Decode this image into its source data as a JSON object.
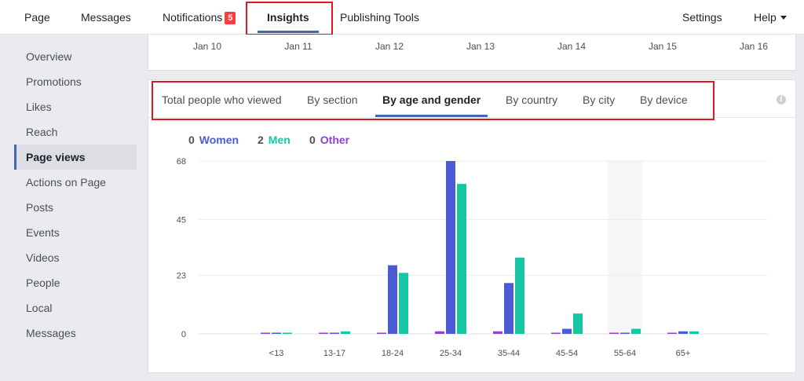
{
  "topnav": {
    "page": "Page",
    "messages": "Messages",
    "notifications": "Notifications",
    "notifications_badge": "5",
    "insights": "Insights",
    "publishing_tools": "Publishing Tools",
    "settings": "Settings",
    "help": "Help"
  },
  "sidebar": {
    "items": [
      {
        "label": "Overview"
      },
      {
        "label": "Promotions"
      },
      {
        "label": "Likes"
      },
      {
        "label": "Reach"
      },
      {
        "label": "Page views"
      },
      {
        "label": "Actions on Page"
      },
      {
        "label": "Posts"
      },
      {
        "label": "Events"
      },
      {
        "label": "Videos"
      },
      {
        "label": "People"
      },
      {
        "label": "Local"
      },
      {
        "label": "Messages"
      }
    ],
    "active_index": 4
  },
  "dates": [
    "Jan 10",
    "Jan 11",
    "Jan 12",
    "Jan 13",
    "Jan 14",
    "Jan 15",
    "Jan 16"
  ],
  "tabs": {
    "total": "Total people who viewed",
    "section": "By section",
    "age_gender": "By age and gender",
    "country": "By country",
    "city": "By city",
    "device": "By device"
  },
  "legend": {
    "women_count": "0",
    "women_label": "Women",
    "men_count": "2",
    "men_label": "Men",
    "other_count": "0",
    "other_label": "Other"
  },
  "colors": {
    "women": "#4c5bd4",
    "men": "#19c6a3",
    "other": "#8e44c8",
    "accent": "#4267b2",
    "highlight_box": "#e0171f"
  },
  "chart_data": {
    "type": "bar",
    "categories": [
      "<13",
      "13-17",
      "18-24",
      "25-34",
      "35-44",
      "45-54",
      "55-64",
      "65+"
    ],
    "series": [
      {
        "name": "Other",
        "values": [
          0,
          0,
          0,
          1,
          1,
          0,
          0,
          0
        ]
      },
      {
        "name": "Women",
        "values": [
          0,
          0,
          27,
          68,
          20,
          2,
          0,
          1
        ]
      },
      {
        "name": "Men",
        "values": [
          0,
          1,
          24,
          59,
          30,
          8,
          2,
          1
        ]
      }
    ],
    "yticks": [
      "68",
      "45",
      "23",
      "0"
    ],
    "ylim": [
      0,
      68
    ],
    "grid": true,
    "highlighted_category": "55-64"
  }
}
